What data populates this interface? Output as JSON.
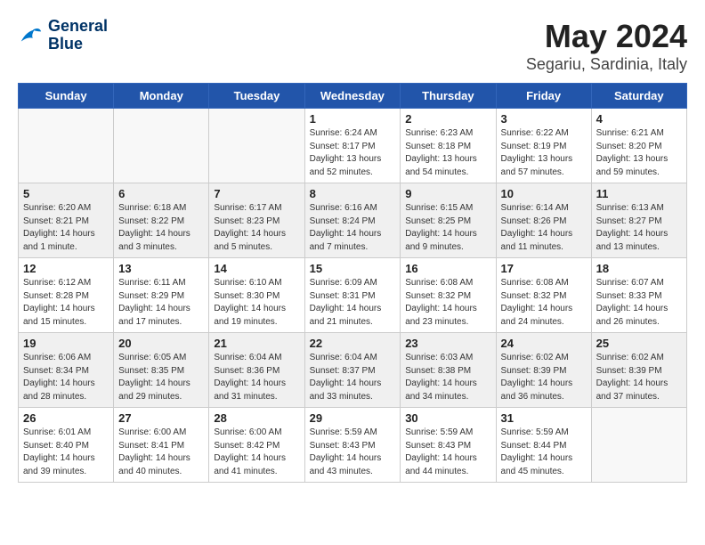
{
  "header": {
    "logo_line1": "General",
    "logo_line2": "Blue",
    "title": "May 2024",
    "subtitle": "Segariu, Sardinia, Italy"
  },
  "days_of_week": [
    "Sunday",
    "Monday",
    "Tuesday",
    "Wednesday",
    "Thursday",
    "Friday",
    "Saturday"
  ],
  "weeks": [
    [
      {
        "day": "",
        "info": ""
      },
      {
        "day": "",
        "info": ""
      },
      {
        "day": "",
        "info": ""
      },
      {
        "day": "1",
        "info": "Sunrise: 6:24 AM\nSunset: 8:17 PM\nDaylight: 13 hours\nand 52 minutes."
      },
      {
        "day": "2",
        "info": "Sunrise: 6:23 AM\nSunset: 8:18 PM\nDaylight: 13 hours\nand 54 minutes."
      },
      {
        "day": "3",
        "info": "Sunrise: 6:22 AM\nSunset: 8:19 PM\nDaylight: 13 hours\nand 57 minutes."
      },
      {
        "day": "4",
        "info": "Sunrise: 6:21 AM\nSunset: 8:20 PM\nDaylight: 13 hours\nand 59 minutes."
      }
    ],
    [
      {
        "day": "5",
        "info": "Sunrise: 6:20 AM\nSunset: 8:21 PM\nDaylight: 14 hours\nand 1 minute."
      },
      {
        "day": "6",
        "info": "Sunrise: 6:18 AM\nSunset: 8:22 PM\nDaylight: 14 hours\nand 3 minutes."
      },
      {
        "day": "7",
        "info": "Sunrise: 6:17 AM\nSunset: 8:23 PM\nDaylight: 14 hours\nand 5 minutes."
      },
      {
        "day": "8",
        "info": "Sunrise: 6:16 AM\nSunset: 8:24 PM\nDaylight: 14 hours\nand 7 minutes."
      },
      {
        "day": "9",
        "info": "Sunrise: 6:15 AM\nSunset: 8:25 PM\nDaylight: 14 hours\nand 9 minutes."
      },
      {
        "day": "10",
        "info": "Sunrise: 6:14 AM\nSunset: 8:26 PM\nDaylight: 14 hours\nand 11 minutes."
      },
      {
        "day": "11",
        "info": "Sunrise: 6:13 AM\nSunset: 8:27 PM\nDaylight: 14 hours\nand 13 minutes."
      }
    ],
    [
      {
        "day": "12",
        "info": "Sunrise: 6:12 AM\nSunset: 8:28 PM\nDaylight: 14 hours\nand 15 minutes."
      },
      {
        "day": "13",
        "info": "Sunrise: 6:11 AM\nSunset: 8:29 PM\nDaylight: 14 hours\nand 17 minutes."
      },
      {
        "day": "14",
        "info": "Sunrise: 6:10 AM\nSunset: 8:30 PM\nDaylight: 14 hours\nand 19 minutes."
      },
      {
        "day": "15",
        "info": "Sunrise: 6:09 AM\nSunset: 8:31 PM\nDaylight: 14 hours\nand 21 minutes."
      },
      {
        "day": "16",
        "info": "Sunrise: 6:08 AM\nSunset: 8:32 PM\nDaylight: 14 hours\nand 23 minutes."
      },
      {
        "day": "17",
        "info": "Sunrise: 6:08 AM\nSunset: 8:32 PM\nDaylight: 14 hours\nand 24 minutes."
      },
      {
        "day": "18",
        "info": "Sunrise: 6:07 AM\nSunset: 8:33 PM\nDaylight: 14 hours\nand 26 minutes."
      }
    ],
    [
      {
        "day": "19",
        "info": "Sunrise: 6:06 AM\nSunset: 8:34 PM\nDaylight: 14 hours\nand 28 minutes."
      },
      {
        "day": "20",
        "info": "Sunrise: 6:05 AM\nSunset: 8:35 PM\nDaylight: 14 hours\nand 29 minutes."
      },
      {
        "day": "21",
        "info": "Sunrise: 6:04 AM\nSunset: 8:36 PM\nDaylight: 14 hours\nand 31 minutes."
      },
      {
        "day": "22",
        "info": "Sunrise: 6:04 AM\nSunset: 8:37 PM\nDaylight: 14 hours\nand 33 minutes."
      },
      {
        "day": "23",
        "info": "Sunrise: 6:03 AM\nSunset: 8:38 PM\nDaylight: 14 hours\nand 34 minutes."
      },
      {
        "day": "24",
        "info": "Sunrise: 6:02 AM\nSunset: 8:39 PM\nDaylight: 14 hours\nand 36 minutes."
      },
      {
        "day": "25",
        "info": "Sunrise: 6:02 AM\nSunset: 8:39 PM\nDaylight: 14 hours\nand 37 minutes."
      }
    ],
    [
      {
        "day": "26",
        "info": "Sunrise: 6:01 AM\nSunset: 8:40 PM\nDaylight: 14 hours\nand 39 minutes."
      },
      {
        "day": "27",
        "info": "Sunrise: 6:00 AM\nSunset: 8:41 PM\nDaylight: 14 hours\nand 40 minutes."
      },
      {
        "day": "28",
        "info": "Sunrise: 6:00 AM\nSunset: 8:42 PM\nDaylight: 14 hours\nand 41 minutes."
      },
      {
        "day": "29",
        "info": "Sunrise: 5:59 AM\nSunset: 8:43 PM\nDaylight: 14 hours\nand 43 minutes."
      },
      {
        "day": "30",
        "info": "Sunrise: 5:59 AM\nSunset: 8:43 PM\nDaylight: 14 hours\nand 44 minutes."
      },
      {
        "day": "31",
        "info": "Sunrise: 5:59 AM\nSunset: 8:44 PM\nDaylight: 14 hours\nand 45 minutes."
      },
      {
        "day": "",
        "info": ""
      }
    ]
  ]
}
